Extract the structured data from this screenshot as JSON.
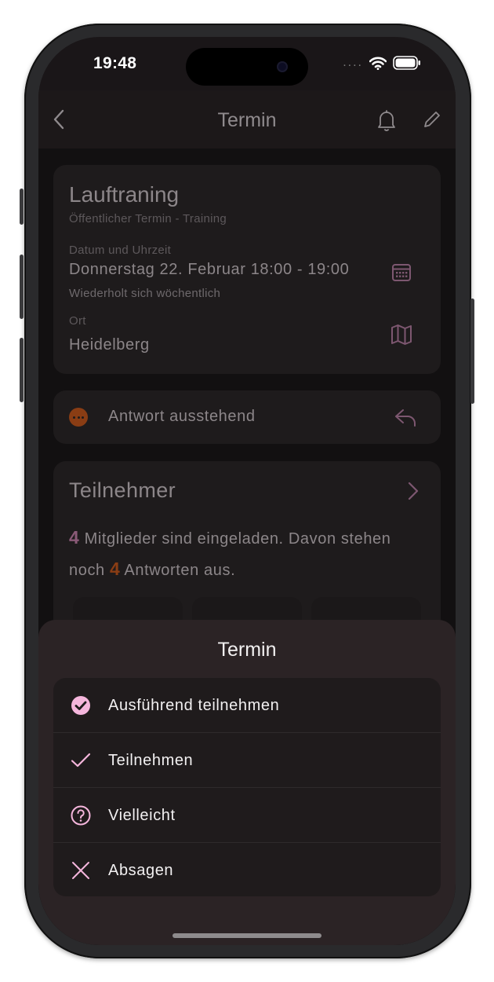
{
  "status_bar": {
    "time": "19:48",
    "signal_dots": "...."
  },
  "navbar": {
    "title": "Termin"
  },
  "event": {
    "title": "Lauftraning",
    "subtitle": "Öffentlicher Termin - Training",
    "datetime_label": "Datum und Uhrzeit",
    "datetime_value": "Donnerstag 22. Februar 18:00 - 19:00",
    "recurrence": "Wiederholt sich wöchentlich",
    "location_label": "Ort",
    "location_value": "Heidelberg"
  },
  "response": {
    "status_text": "Antwort ausstehend"
  },
  "participants": {
    "title": "Teilnehmer",
    "invited_count": "4",
    "text_part1": "Mitglieder sind eingeladen. Davon stehen noch",
    "pending_count": "4",
    "text_part2": "Antworten aus."
  },
  "sheet": {
    "title": "Termin",
    "options": [
      {
        "label": "Ausführend teilnehmen",
        "icon": "check-circle-icon"
      },
      {
        "label": "Teilnehmen",
        "icon": "check-icon"
      },
      {
        "label": "Vielleicht",
        "icon": "question-circle-icon"
      },
      {
        "label": "Absagen",
        "icon": "close-icon"
      }
    ]
  },
  "colors": {
    "accent_pink": "#f5b6dc",
    "pending_orange": "#8a3d14",
    "sheet_bg": "#2b2325",
    "menu_bg": "#1f1b1c"
  }
}
